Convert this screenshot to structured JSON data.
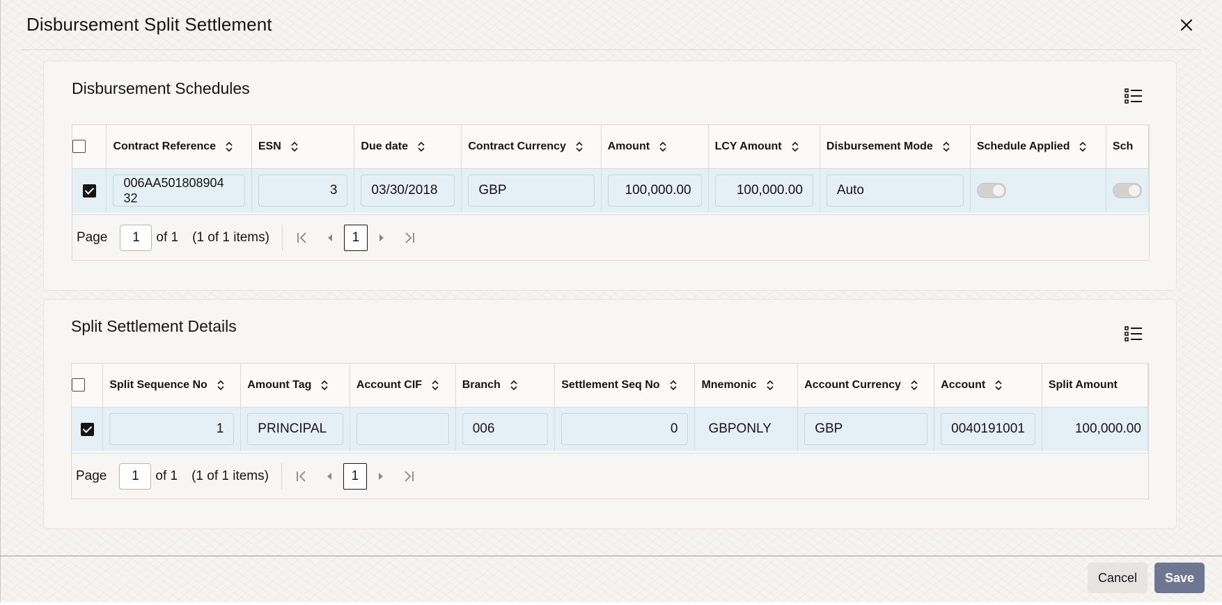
{
  "dialog": {
    "title": "Disbursement Split Settlement"
  },
  "icons": {
    "close": "close-icon",
    "view": "list-view-icon",
    "sort": "sort-icon"
  },
  "disbursement_schedules": {
    "title": "Disbursement Schedules",
    "columns": [
      "Contract Reference",
      "ESN",
      "Due date",
      "Contract Currency",
      "Amount",
      "LCY Amount",
      "Disbursement Mode",
      "Schedule Applied",
      "Sch"
    ],
    "row": {
      "selected": true,
      "contract_reference": "006AA501808904 32",
      "esn": "3",
      "due_date": "03/30/2018",
      "contract_currency": "GBP",
      "amount": "100,000.00",
      "lcy_amount": "100,000.00",
      "disbursement_mode": "Auto",
      "schedule_applied": false
    },
    "pager": {
      "page_label": "Page",
      "page": "1",
      "of_label": "of 1",
      "items": "(1 of 1 items)",
      "current": "1"
    }
  },
  "split_settlement_details": {
    "title": "Split Settlement Details",
    "columns": [
      "Split Sequence No",
      "Amount Tag",
      "Account CIF",
      "Branch",
      "Settlement Seq No",
      "Mnemonic",
      "Account Currency",
      "Account",
      "Split Amount"
    ],
    "row": {
      "selected": true,
      "split_sequence_no": "1",
      "amount_tag": "PRINCIPAL",
      "account_cif": "",
      "branch": "006",
      "settlement_seq_no": "0",
      "mnemonic": "GBPONLY",
      "account_currency": "GBP",
      "account": "0040191001",
      "split_amount": "100,000.00"
    },
    "pager": {
      "page_label": "Page",
      "page": "1",
      "of_label": "of 1",
      "items": "(1 of 1 items)",
      "current": "1"
    }
  },
  "footer": {
    "cancel_label": "Cancel",
    "save_label": "Save"
  }
}
